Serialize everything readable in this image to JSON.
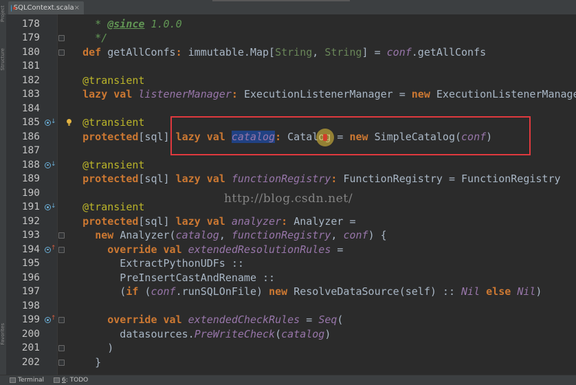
{
  "tab": {
    "title": "SQLContext.scala",
    "close": "×"
  },
  "side_labels": [
    "Project",
    "Structure",
    "Favorites"
  ],
  "watermark": "http://blog.csdn.net/",
  "status": {
    "terminal": "Terminal",
    "todo_num": "6",
    "todo_label": ": TODO"
  },
  "lines": [
    {
      "n": "178",
      "t": [
        [
          "c-doc",
          "  * "
        ],
        [
          "c-tag",
          "@since"
        ],
        [
          "c-doc",
          " 1.0.0"
        ]
      ]
    },
    {
      "n": "179",
      "t": [
        [
          "c-doc",
          "  */"
        ]
      ]
    },
    {
      "n": "180",
      "t": [
        [
          "c-kw",
          "def "
        ],
        [
          "",
          "getAllConfs"
        ],
        [
          "c-kw",
          ": "
        ],
        [
          "",
          "immutable.Map["
        ],
        [
          "c-type",
          "String"
        ],
        [
          "",
          ", "
        ],
        [
          "c-type",
          "String"
        ],
        [
          "",
          "] = "
        ],
        [
          "c-it",
          "conf"
        ],
        [
          "",
          ".getAllConfs"
        ]
      ]
    },
    {
      "n": "181",
      "t": []
    },
    {
      "n": "182",
      "t": [
        [
          "c-ann",
          "@transient"
        ]
      ]
    },
    {
      "n": "183",
      "t": [
        [
          "c-kw",
          "lazy val "
        ],
        [
          "c-it",
          "listenerManager"
        ],
        [
          "c-kw",
          ": "
        ],
        [
          "",
          "ExecutionListenerManager = "
        ],
        [
          "c-kw",
          "new "
        ],
        [
          "",
          "ExecutionListenerManager"
        ]
      ]
    },
    {
      "n": "184",
      "t": []
    },
    {
      "n": "185",
      "t": [
        [
          "c-ann",
          "@transient"
        ]
      ]
    },
    {
      "n": "186",
      "t": [
        [
          "c-kw",
          "protected"
        ],
        [
          "",
          "[sql] "
        ],
        [
          "c-kw",
          "lazy val "
        ],
        [
          "c-sel",
          "catalog"
        ],
        [
          "c-kw",
          ": "
        ],
        [
          "",
          "Catalog = "
        ],
        [
          "c-kw",
          "new "
        ],
        [
          "",
          "SimpleCatalog("
        ],
        [
          "c-it",
          "conf"
        ],
        [
          "",
          ")"
        ]
      ]
    },
    {
      "n": "187",
      "t": []
    },
    {
      "n": "188",
      "t": [
        [
          "c-ann",
          "@transient"
        ]
      ]
    },
    {
      "n": "189",
      "t": [
        [
          "c-kw",
          "protected"
        ],
        [
          "",
          "[sql] "
        ],
        [
          "c-kw",
          "lazy val "
        ],
        [
          "c-it",
          "functionRegistry"
        ],
        [
          "c-kw",
          ": "
        ],
        [
          "",
          "FunctionRegistry = FunctionRegistry"
        ]
      ]
    },
    {
      "n": "190",
      "t": []
    },
    {
      "n": "191",
      "t": [
        [
          "c-ann",
          "@transient"
        ]
      ]
    },
    {
      "n": "192",
      "t": [
        [
          "c-kw",
          "protected"
        ],
        [
          "",
          "[sql] "
        ],
        [
          "c-kw",
          "lazy val "
        ],
        [
          "c-it",
          "analyzer"
        ],
        [
          "c-kw",
          ": "
        ],
        [
          "",
          "Analyzer ="
        ]
      ]
    },
    {
      "n": "193",
      "t": [
        [
          "",
          "  "
        ],
        [
          "c-kw",
          "new "
        ],
        [
          "",
          "Analyzer("
        ],
        [
          "c-it",
          "catalog"
        ],
        [
          "",
          ", "
        ],
        [
          "c-it",
          "functionRegistry"
        ],
        [
          "",
          ", "
        ],
        [
          "c-it",
          "conf"
        ],
        [
          "",
          ") {"
        ]
      ]
    },
    {
      "n": "194",
      "t": [
        [
          "",
          "    "
        ],
        [
          "c-kw",
          "override val "
        ],
        [
          "c-it",
          "extendedResolutionRules"
        ],
        [
          "",
          " ="
        ]
      ]
    },
    {
      "n": "195",
      "t": [
        [
          "",
          "      ExtractPythonUDFs ::"
        ]
      ]
    },
    {
      "n": "196",
      "t": [
        [
          "",
          "      PreInsertCastAndRename ::"
        ]
      ]
    },
    {
      "n": "197",
      "t": [
        [
          "",
          "      ("
        ],
        [
          "c-kw",
          "if "
        ],
        [
          "",
          "("
        ],
        [
          "c-it",
          "conf"
        ],
        [
          "",
          ".runSQLOnFile) "
        ],
        [
          "c-kw",
          "new "
        ],
        [
          "",
          "ResolveDataSource(self) :: "
        ],
        [
          "c-it",
          "Nil "
        ],
        [
          "c-kw",
          "else "
        ],
        [
          "c-it",
          "Nil"
        ],
        [
          "",
          ")"
        ]
      ]
    },
    {
      "n": "198",
      "t": []
    },
    {
      "n": "199",
      "t": [
        [
          "",
          "    "
        ],
        [
          "c-kw",
          "override val "
        ],
        [
          "c-it",
          "extendedCheckRules"
        ],
        [
          "",
          " = "
        ],
        [
          "c-it",
          "Seq"
        ],
        [
          "",
          "("
        ]
      ]
    },
    {
      "n": "200",
      "t": [
        [
          "",
          "      datasources."
        ],
        [
          "c-it",
          "PreWriteCheck"
        ],
        [
          "",
          "("
        ],
        [
          "c-it",
          "catalog"
        ],
        [
          "",
          ")"
        ]
      ]
    },
    {
      "n": "201",
      "t": [
        [
          "",
          "    )"
        ]
      ]
    },
    {
      "n": "202",
      "t": [
        [
          "",
          "  }"
        ]
      ]
    }
  ]
}
